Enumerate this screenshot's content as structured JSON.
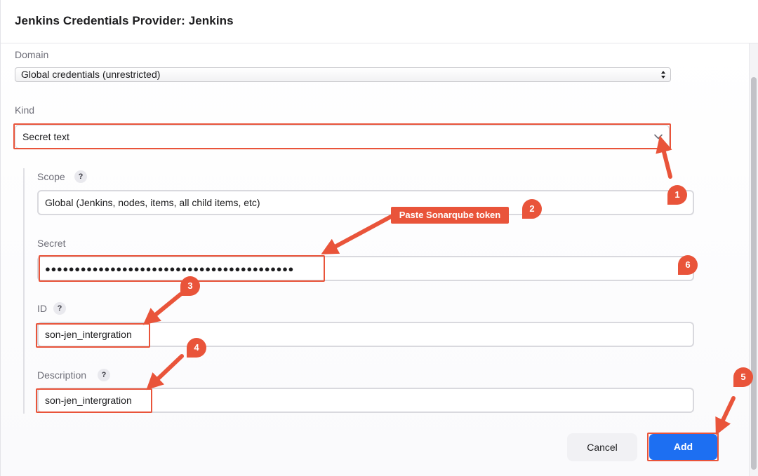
{
  "dialog": {
    "title": "Jenkins Credentials Provider: Jenkins"
  },
  "domain": {
    "label": "Domain",
    "value": "Global credentials (unrestricted)"
  },
  "kind": {
    "label": "Kind",
    "value": "Secret text"
  },
  "scope": {
    "label": "Scope",
    "help": "?",
    "value": "Global (Jenkins, nodes, items, all child items, etc)"
  },
  "secret": {
    "label": "Secret",
    "value": "●●●●●●●●●●●●●●●●●●●●●●●●●●●●●●●●●●●●●●●●●●"
  },
  "id_field": {
    "label": "ID",
    "help": "?",
    "value": "son-jen_intergration"
  },
  "description": {
    "label": "Description",
    "help": "?",
    "value": "son-jen_intergration"
  },
  "buttons": {
    "cancel": "Cancel",
    "add": "Add"
  },
  "annotations": {
    "callout": "Paste Sonarqube token",
    "badges": [
      "1",
      "2",
      "3",
      "4",
      "5",
      "6"
    ],
    "accent_color": "#e9543a"
  },
  "colors": {
    "primary_button": "#1d6ff2"
  }
}
